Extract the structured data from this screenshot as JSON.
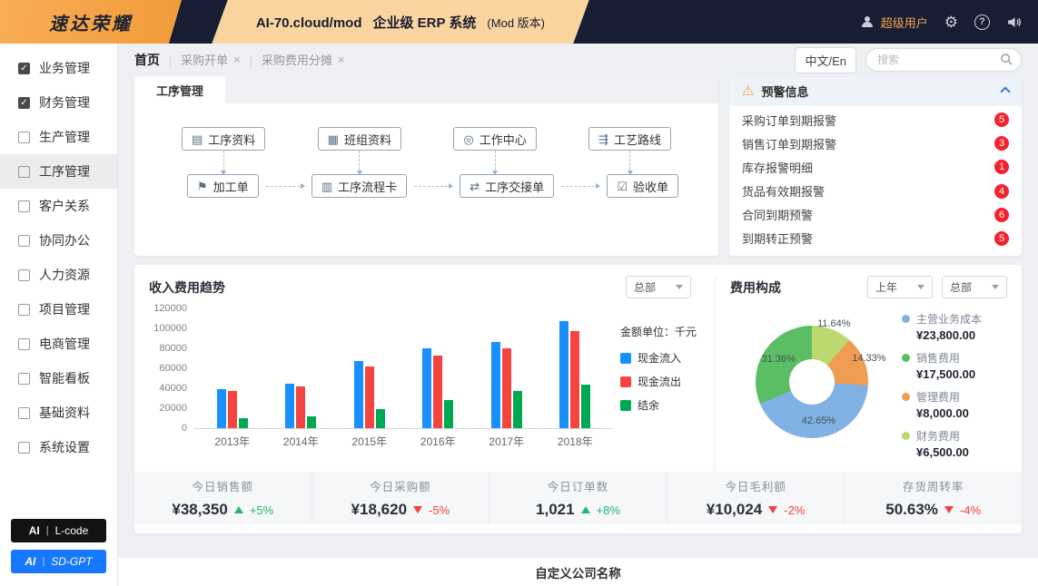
{
  "header": {
    "logo": "速达荣耀",
    "product": "AI-70.cloud/mod",
    "system": "企业级 ERP 系统",
    "version": "(Mod 版本)",
    "user": "超级用户"
  },
  "sidebar": {
    "items": [
      {
        "label": "业务管理",
        "checked": true,
        "active": false
      },
      {
        "label": "财务管理",
        "checked": true,
        "active": false
      },
      {
        "label": "生产管理",
        "checked": false,
        "active": false
      },
      {
        "label": "工序管理",
        "checked": false,
        "active": true
      },
      {
        "label": "客户关系",
        "checked": false,
        "active": false
      },
      {
        "label": "协同办公",
        "checked": false,
        "active": false
      },
      {
        "label": "人力资源",
        "checked": false,
        "active": false
      },
      {
        "label": "项目管理",
        "checked": false,
        "active": false
      },
      {
        "label": "电商管理",
        "checked": false,
        "active": false
      },
      {
        "label": "智能看板",
        "checked": false,
        "active": false
      },
      {
        "label": "基础资料",
        "checked": false,
        "active": false
      },
      {
        "label": "系统设置",
        "checked": false,
        "active": false
      }
    ],
    "ai_buttons": [
      {
        "prefix": "AI",
        "label": "L-code",
        "style": "black"
      },
      {
        "prefix": "AI",
        "label": "SD-GPT",
        "style": "blue"
      }
    ]
  },
  "breadcrumb": {
    "home": "首页",
    "tabs": [
      "采购开单",
      "采购费用分摊"
    ]
  },
  "topbar": {
    "lang_button": "中文/En",
    "search_placeholder": "搜索"
  },
  "process_panel": {
    "tab": "工序管理",
    "row1": [
      {
        "label": "工序资料",
        "icon": "▤"
      },
      {
        "label": "班组资料",
        "icon": "▦"
      },
      {
        "label": "工作中心",
        "icon": "◎"
      },
      {
        "label": "工艺路线",
        "icon": "⇶"
      }
    ],
    "row2": [
      {
        "label": "加工单",
        "icon": "⚑"
      },
      {
        "label": "工序流程卡",
        "icon": "▥"
      },
      {
        "label": "工序交接单",
        "icon": "⇄"
      },
      {
        "label": "验收单",
        "icon": "☑"
      }
    ]
  },
  "alerts_panel": {
    "title": "预警信息",
    "items": [
      {
        "label": "采购订单到期报警",
        "count": 5
      },
      {
        "label": "销售订单到期报警",
        "count": 3
      },
      {
        "label": "库存报警明细",
        "count": 1
      },
      {
        "label": "货品有效期报警",
        "count": 4
      },
      {
        "label": "合同到期预警",
        "count": 6
      },
      {
        "label": "到期转正预警",
        "count": 5
      }
    ]
  },
  "chart_data": [
    {
      "type": "bar",
      "title": "收入费用趋势",
      "filter": "总部",
      "unit_label": "金额单位：千元",
      "categories": [
        "2013年",
        "2014年",
        "2015年",
        "2016年",
        "2017年",
        "2018年"
      ],
      "series": [
        {
          "name": "现金流入",
          "color": "#1890ff",
          "values": [
            39000,
            45000,
            67000,
            80000,
            86000,
            107000
          ]
        },
        {
          "name": "现金流出",
          "color": "#f5433f",
          "values": [
            37000,
            42000,
            62000,
            73000,
            80000,
            97000
          ]
        },
        {
          "name": "结余",
          "color": "#00a854",
          "values": [
            10000,
            12000,
            19000,
            28000,
            37000,
            44000
          ]
        }
      ],
      "ylim": [
        0,
        120000
      ],
      "yticks": [
        0,
        20000,
        40000,
        60000,
        80000,
        100000,
        120000
      ],
      "grid": false,
      "legend_position": "right"
    },
    {
      "type": "pie",
      "title": "费用构成",
      "filters": [
        "上年",
        "总部"
      ],
      "donut": true,
      "slices": [
        {
          "name": "主营业务成本",
          "value_label": "¥23,800.00",
          "pct": 42.65,
          "pct_label": "42.65%",
          "color": "#7fb2e3"
        },
        {
          "name": "销售费用",
          "value_label": "¥17,500.00",
          "pct": 31.36,
          "pct_label": "31.36%",
          "color": "#5bbd64"
        },
        {
          "name": "管理费用",
          "value_label": "¥8,000.00",
          "pct": 14.33,
          "pct_label": "14.33%",
          "color": "#ef9d52"
        },
        {
          "name": "财务费用",
          "value_label": "¥6,500.00",
          "pct": 11.64,
          "pct_label": "11.64%",
          "color": "#bcd96f"
        }
      ],
      "draw_order": [
        3,
        2,
        0,
        1
      ]
    }
  ],
  "stats": [
    {
      "label": "今日销售额",
      "value": "¥38,350",
      "trend": "up",
      "pct": "+5%"
    },
    {
      "label": "今日采购额",
      "value": "¥18,620",
      "trend": "down",
      "pct": "-5%"
    },
    {
      "label": "今日订单数",
      "value": "1,021",
      "trend": "up",
      "pct": "+8%"
    },
    {
      "label": "今日毛利额",
      "value": "¥10,024",
      "trend": "down",
      "pct": "-2%"
    },
    {
      "label": "存货周转率",
      "value": "50.63%",
      "trend": "down",
      "pct": "-4%"
    }
  ],
  "footer": {
    "company": "自定义公司名称"
  }
}
